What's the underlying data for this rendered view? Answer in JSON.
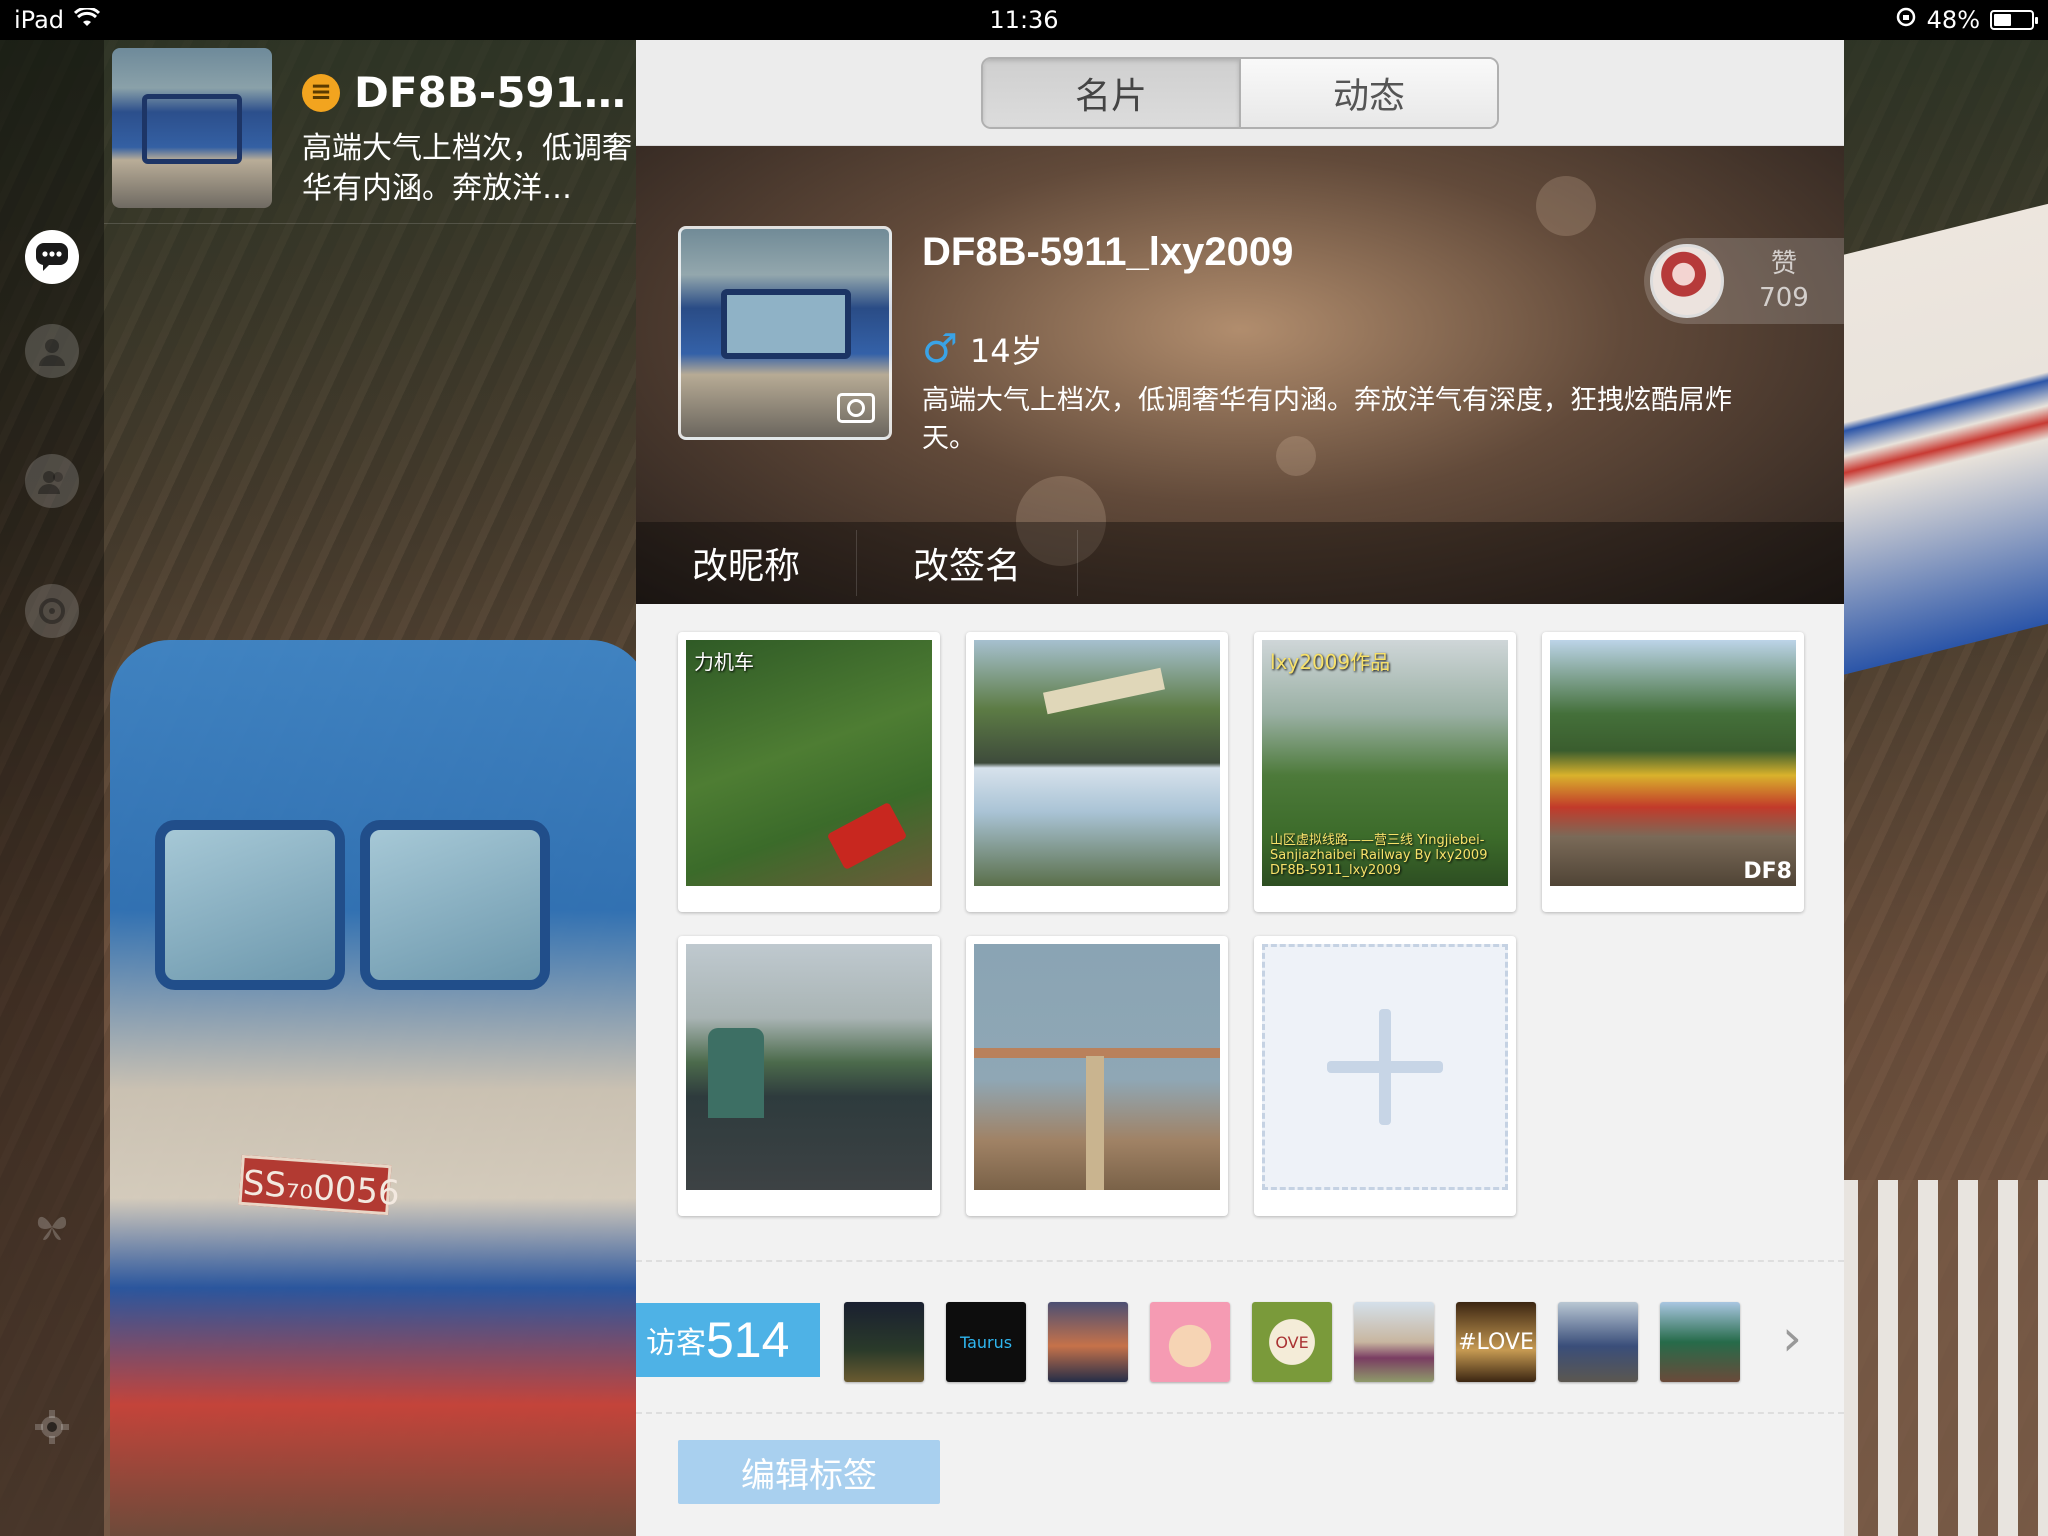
{
  "status_bar": {
    "device": "iPad",
    "time": "11:36",
    "battery_percent": "48%",
    "battery_level": 0.48,
    "wifi_icon": "wifi-icon",
    "rotation_lock_icon": "rotation-lock-icon"
  },
  "sidebar": {
    "items": [
      {
        "name": "sidebar-item-messages",
        "icon": "chat-bubble-icon",
        "glyph": "…",
        "active": true
      },
      {
        "name": "sidebar-item-contacts",
        "icon": "person-icon",
        "glyph": "●"
      },
      {
        "name": "sidebar-item-groups",
        "icon": "group-icon",
        "glyph": "●"
      },
      {
        "name": "sidebar-item-discover",
        "icon": "discover-icon",
        "glyph": "✿"
      },
      {
        "name": "sidebar-item-plugins",
        "icon": "butterfly-icon",
        "glyph": "❦"
      },
      {
        "name": "sidebar-item-settings",
        "icon": "gear-icon",
        "glyph": "⚙"
      }
    ]
  },
  "left_profile": {
    "name": "DF8B-591…",
    "signature": "高端大气上档次，低调奢华有内涵。奔放洋…",
    "badge_glyph": "≡"
  },
  "tabs": [
    {
      "label": "名片",
      "active": true
    },
    {
      "label": "动态",
      "active": false
    }
  ],
  "profile": {
    "name": "DF8B-5911_lxy2009",
    "gender_symbol": "♂",
    "age": "14岁",
    "signature": "高端大气上档次，低调奢华有内涵。奔放洋气有深度，狂拽炫酷屌炸天。",
    "like_label": "赞",
    "like_count": "709"
  },
  "actions": {
    "edit_nickname": "改昵称",
    "edit_signature": "改签名"
  },
  "photos": [
    {
      "label": "力机车",
      "caption": "",
      "corner": ""
    },
    {
      "label": "",
      "caption": "",
      "corner": ""
    },
    {
      "label": "lxy2009作品",
      "caption": "山区虚拟线路——营三线 Yingjiebei-Sanjiazhaibei Railway By lxy2009 DF8B-5911_lxy2009",
      "corner": ""
    },
    {
      "label": "",
      "caption": "",
      "corner": "DF8"
    },
    {
      "label": "",
      "caption": "",
      "corner": ""
    },
    {
      "label": "",
      "caption": "",
      "corner": ""
    }
  ],
  "visitors": {
    "label": "访客",
    "count": "514",
    "thumbs": [
      "",
      "Taurus",
      "",
      "",
      "OVE",
      "",
      "#LOVE",
      "",
      ""
    ]
  },
  "edit_tags": "编辑标签",
  "colors": {
    "accent_blue": "#4eb2e6",
    "gender_blue": "#3aa3e6",
    "badge_orange": "#f2a41f",
    "edit_tags_bg": "#a9d0ef"
  }
}
